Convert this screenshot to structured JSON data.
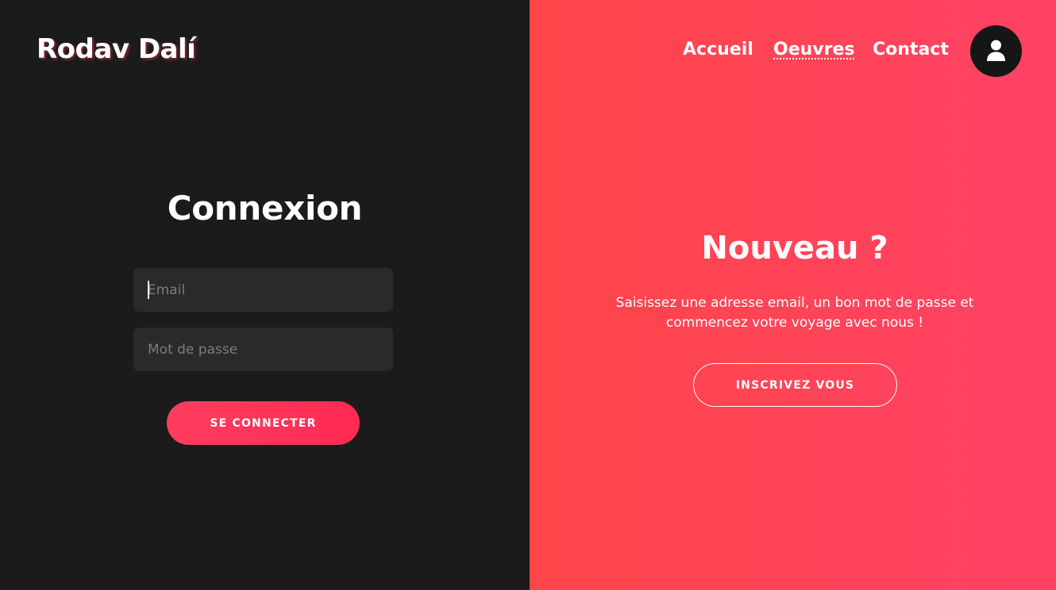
{
  "brand": {
    "name": "Rodav Dalí"
  },
  "nav": {
    "items": [
      {
        "label": "Accueil",
        "active": false
      },
      {
        "label": "Oeuvres",
        "active": true
      },
      {
        "label": "Contact",
        "active": false
      }
    ],
    "profile_icon": "user-icon"
  },
  "login": {
    "title": "Connexion",
    "email_placeholder": "Email",
    "email_value": "",
    "password_placeholder": "Mot de passe",
    "password_value": "",
    "submit_label": "SE CONNECTER"
  },
  "signup": {
    "title": "Nouveau ?",
    "text": "Saisissez une adresse email, un bon mot de passe et commencez votre voyage avec nous !",
    "button_label": "INSCRIVEZ VOUS"
  },
  "colors": {
    "left_background": "#1b1b1b",
    "accent_start": "#ff4549",
    "accent_end": "#ff4265",
    "button": "#ff2b54",
    "input_background": "#2a2a2a"
  }
}
